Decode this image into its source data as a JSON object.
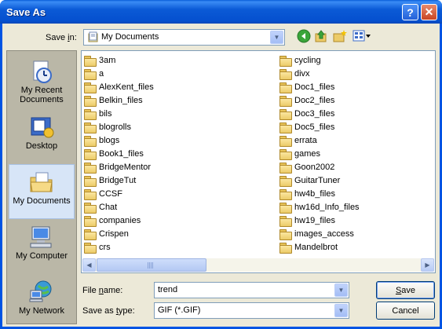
{
  "window": {
    "title": "Save As"
  },
  "toolbar": {
    "save_in_label": "Save in:",
    "save_in_value": "My Documents"
  },
  "places": [
    {
      "label": "My Recent Documents",
      "icon": "recent-documents-icon"
    },
    {
      "label": "Desktop",
      "icon": "desktop-icon"
    },
    {
      "label": "My Documents",
      "icon": "my-documents-icon",
      "selected": true
    },
    {
      "label": "My Computer",
      "icon": "my-computer-icon"
    },
    {
      "label": "My Network",
      "icon": "my-network-icon"
    }
  ],
  "files": {
    "col1": [
      "3am",
      "a",
      "AlexKent_files",
      "Belkin_files",
      "bils",
      "blogrolls",
      "blogs",
      "Book1_files",
      "BridgeMentor",
      "BridgeTut",
      "CCSF",
      "Chat",
      "companies",
      "Crispen",
      "crs"
    ],
    "col2": [
      "cycling",
      "divx",
      "Doc1_files",
      "Doc2_files",
      "Doc3_files",
      "Doc5_files",
      "errata",
      "games",
      "Goon2002",
      "GuitarTuner",
      "hw4b_files",
      "hw16d_Info_files",
      "hw19_files",
      "images_access",
      "Mandelbrot"
    ]
  },
  "form": {
    "file_name_label": "File name:",
    "file_name_value": "trend",
    "save_as_type_label": "Save as type:",
    "save_as_type_value": "GIF (*.GIF)"
  },
  "buttons": {
    "save": "Save",
    "cancel": "Cancel"
  }
}
